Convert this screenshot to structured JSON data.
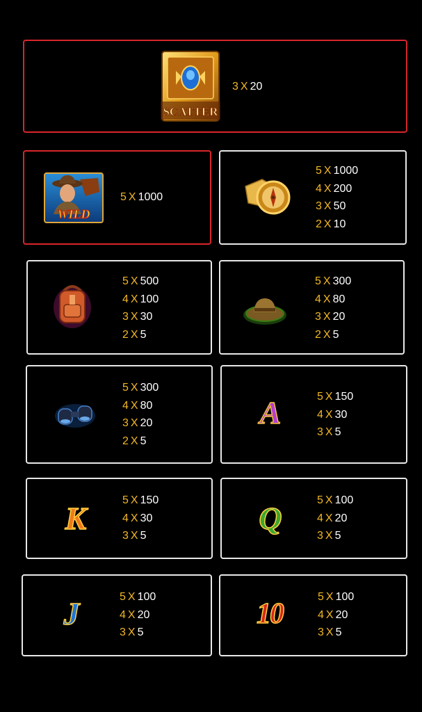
{
  "colors": {
    "count": "#f3b726",
    "amount": "#ffffff",
    "red_border": "#d8262b",
    "white_border": "#e8e8e8"
  },
  "symbols": [
    {
      "id": "scatter",
      "icon": "scatter-book-icon",
      "icon_text": "SCATTER",
      "pays": [
        {
          "count": "3",
          "x": "X",
          "amount": "20"
        }
      ]
    },
    {
      "id": "wild",
      "icon": "wild-explorer-icon",
      "icon_text": "WILD",
      "pays": [
        {
          "count": "5",
          "x": "X",
          "amount": "1000"
        }
      ]
    },
    {
      "id": "compass",
      "icon": "compass-map-icon",
      "pays": [
        {
          "count": "5",
          "x": "X",
          "amount": "1000"
        },
        {
          "count": "4",
          "x": "X",
          "amount": "200"
        },
        {
          "count": "3",
          "x": "X",
          "amount": "50"
        },
        {
          "count": "2",
          "x": "X",
          "amount": "10"
        }
      ]
    },
    {
      "id": "backpack",
      "icon": "backpack-icon",
      "pays": [
        {
          "count": "5",
          "x": "X",
          "amount": "500"
        },
        {
          "count": "4",
          "x": "X",
          "amount": "100"
        },
        {
          "count": "3",
          "x": "X",
          "amount": "30"
        },
        {
          "count": "2",
          "x": "X",
          "amount": "5"
        }
      ]
    },
    {
      "id": "hat",
      "icon": "explorer-hat-icon",
      "pays": [
        {
          "count": "5",
          "x": "X",
          "amount": "300"
        },
        {
          "count": "4",
          "x": "X",
          "amount": "80"
        },
        {
          "count": "3",
          "x": "X",
          "amount": "20"
        },
        {
          "count": "2",
          "x": "X",
          "amount": "5"
        }
      ]
    },
    {
      "id": "binoculars",
      "icon": "binoculars-icon",
      "pays": [
        {
          "count": "5",
          "x": "X",
          "amount": "300"
        },
        {
          "count": "4",
          "x": "X",
          "amount": "80"
        },
        {
          "count": "3",
          "x": "X",
          "amount": "20"
        },
        {
          "count": "2",
          "x": "X",
          "amount": "5"
        }
      ]
    },
    {
      "id": "A",
      "icon": "letter-a-icon",
      "icon_text": "A",
      "pays": [
        {
          "count": "5",
          "x": "X",
          "amount": "150"
        },
        {
          "count": "4",
          "x": "X",
          "amount": "30"
        },
        {
          "count": "3",
          "x": "X",
          "amount": "5"
        }
      ]
    },
    {
      "id": "K",
      "icon": "letter-k-icon",
      "icon_text": "K",
      "pays": [
        {
          "count": "5",
          "x": "X",
          "amount": "150"
        },
        {
          "count": "4",
          "x": "X",
          "amount": "30"
        },
        {
          "count": "3",
          "x": "X",
          "amount": "5"
        }
      ]
    },
    {
      "id": "Q",
      "icon": "letter-q-icon",
      "icon_text": "Q",
      "pays": [
        {
          "count": "5",
          "x": "X",
          "amount": "100"
        },
        {
          "count": "4",
          "x": "X",
          "amount": "20"
        },
        {
          "count": "3",
          "x": "X",
          "amount": "5"
        }
      ]
    },
    {
      "id": "J",
      "icon": "letter-j-icon",
      "icon_text": "J",
      "pays": [
        {
          "count": "5",
          "x": "X",
          "amount": "100"
        },
        {
          "count": "4",
          "x": "X",
          "amount": "20"
        },
        {
          "count": "3",
          "x": "X",
          "amount": "5"
        }
      ]
    },
    {
      "id": "10",
      "icon": "number-10-icon",
      "icon_text": "10",
      "pays": [
        {
          "count": "5",
          "x": "X",
          "amount": "100"
        },
        {
          "count": "4",
          "x": "X",
          "amount": "20"
        },
        {
          "count": "3",
          "x": "X",
          "amount": "5"
        }
      ]
    }
  ]
}
